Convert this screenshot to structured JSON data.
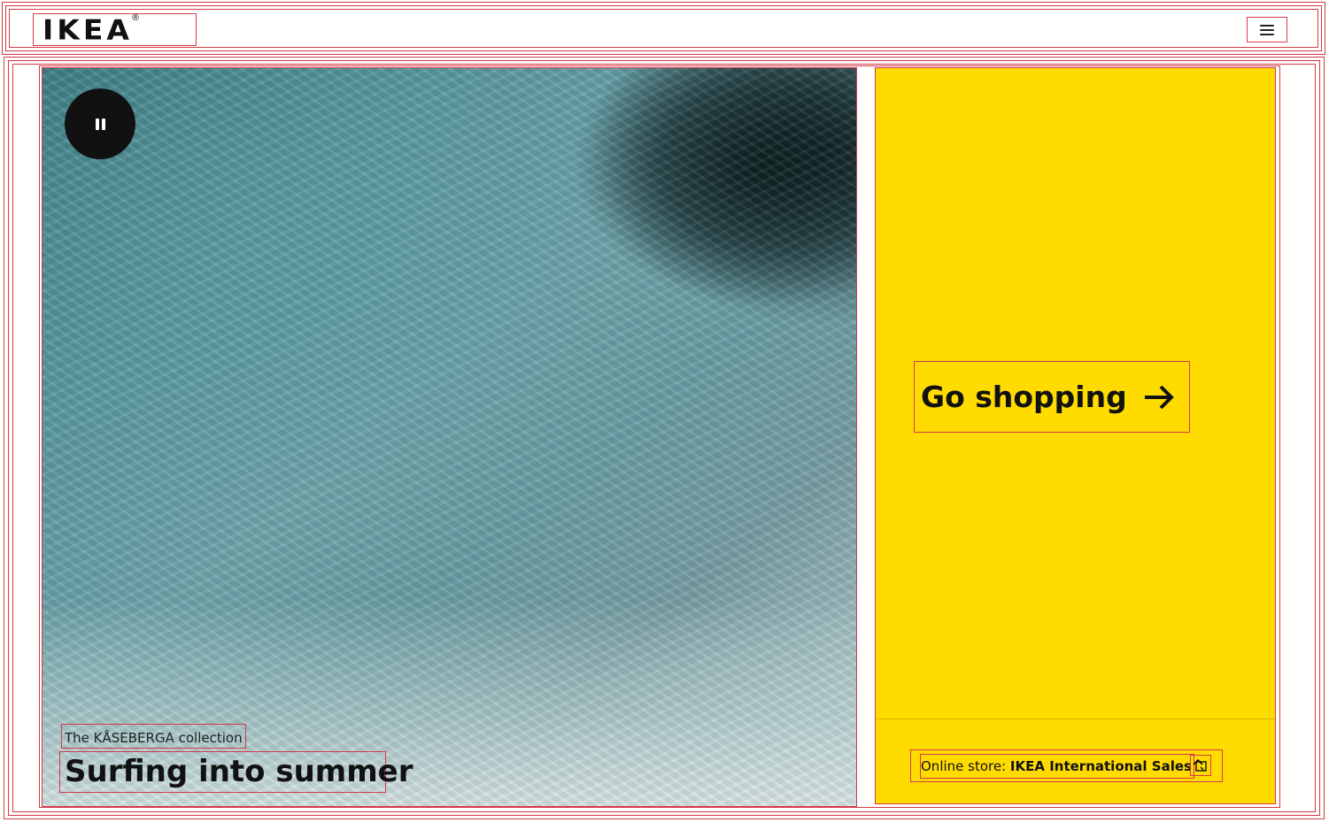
{
  "header": {
    "logo_text": "IKEA",
    "logo_reg": "®",
    "menu_icon": "menu-icon"
  },
  "hero": {
    "pause_icon": "pause-icon",
    "eyebrow": "The KÅSEBERGA collection",
    "title": "Surfing into summer"
  },
  "shop_panel": {
    "background": "#ffdb00",
    "go_shopping_label": "Go shopping",
    "arrow_icon": "arrow-right-icon",
    "store_prefix": "Online store: ",
    "store_name": "IKEA International Sales",
    "store_icon": "store-switch-icon"
  }
}
